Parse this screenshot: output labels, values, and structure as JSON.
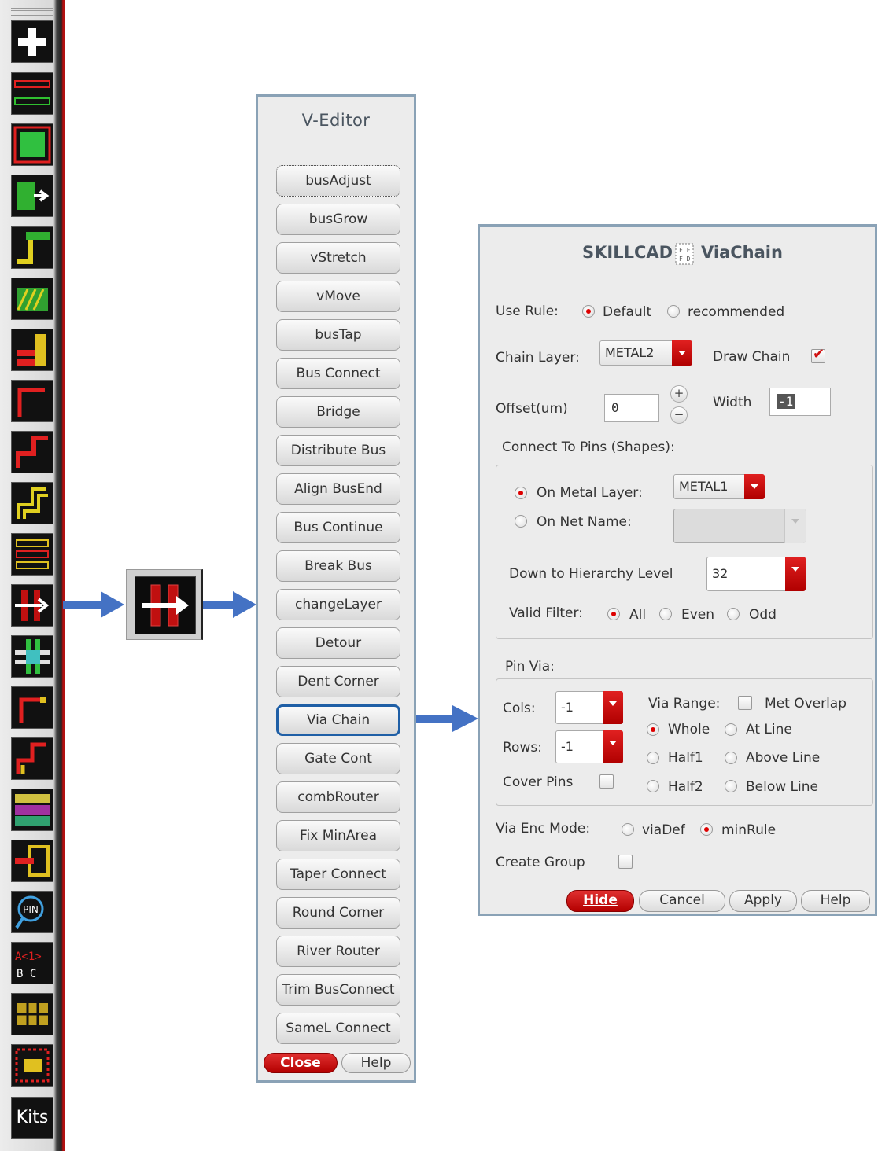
{
  "toolbar": {
    "icons": [
      "add-icon",
      "bus-lines-icon",
      "green-fill-icon",
      "bus-move-icon",
      "route-step-icon",
      "hatched-shape-icon",
      "bus-stack-icon",
      "route-corner-icon",
      "route-jog-icon",
      "multi-route-icon",
      "bus-break-icon",
      "via-chain-icon",
      "cross-connect-icon",
      "route-corner-small-icon",
      "route-jog-small-icon",
      "pattern-fill-icon",
      "bus-tap-icon",
      "pin-search-icon",
      "bus-label-icon",
      "grid-pattern-icon",
      "array-pattern-icon"
    ],
    "kits_label": "Kits"
  },
  "veditor": {
    "title": "V-Editor",
    "buttons": [
      "busAdjust",
      "busGrow",
      "vStretch",
      "vMove",
      "busTap",
      "Bus Connect",
      "Bridge",
      "Distribute Bus",
      "Align BusEnd",
      "Bus Continue",
      "Break Bus",
      "changeLayer",
      "Detour",
      "Dent Corner",
      "Via Chain",
      "Gate Cont",
      "combRouter",
      "Fix MinArea",
      "Taper Connect",
      "Round Corner",
      "River Router",
      "Trim BusConnect",
      "SameL Connect"
    ],
    "selected": "Via Chain",
    "close_label": "Close",
    "help_label": "Help"
  },
  "viachain": {
    "title_left": "SKILLCAD",
    "title_right": "ViaChain",
    "use_rule_label": "Use Rule:",
    "use_rule_default": "Default",
    "use_rule_recommended": "recommended",
    "chain_layer_label": "Chain Layer:",
    "chain_layer_value": "METAL2",
    "draw_chain_label": "Draw Chain",
    "offset_label": "Offset(um)",
    "offset_value": "0",
    "width_label": "Width",
    "width_value": "-1",
    "connect_label": "Connect To Pins (Shapes):",
    "on_metal_label": "On Metal Layer:",
    "on_metal_value": "METAL1",
    "on_net_label": "On Net Name:",
    "hierarchy_label": "Down to Hierarchy Level",
    "hierarchy_value": "32",
    "valid_filter_label": "Valid Filter:",
    "filter_all": "All",
    "filter_even": "Even",
    "filter_odd": "Odd",
    "pin_via_label": "Pin Via:",
    "cols_label": "Cols:",
    "cols_value": "-1",
    "rows_label": "Rows:",
    "rows_value": "-1",
    "cover_pins_label": "Cover Pins",
    "via_range_label": "Via Range:",
    "met_overlap_label": "Met Overlap",
    "range_whole": "Whole",
    "range_at_line": "At Line",
    "range_half1": "Half1",
    "range_above_line": "Above Line",
    "range_half2": "Half2",
    "range_below_line": "Below Line",
    "via_enc_label": "Via Enc Mode:",
    "enc_viadef": "viaDef",
    "enc_minrule": "minRule",
    "create_group_label": "Create Group",
    "hide_label": "Hide",
    "cancel_label": "Cancel",
    "apply_label": "Apply",
    "help_label": "Help"
  },
  "colors": {
    "accent_red": "#d01010",
    "selection_blue": "#1f5fa6",
    "arrow_blue": "#4472c4"
  }
}
